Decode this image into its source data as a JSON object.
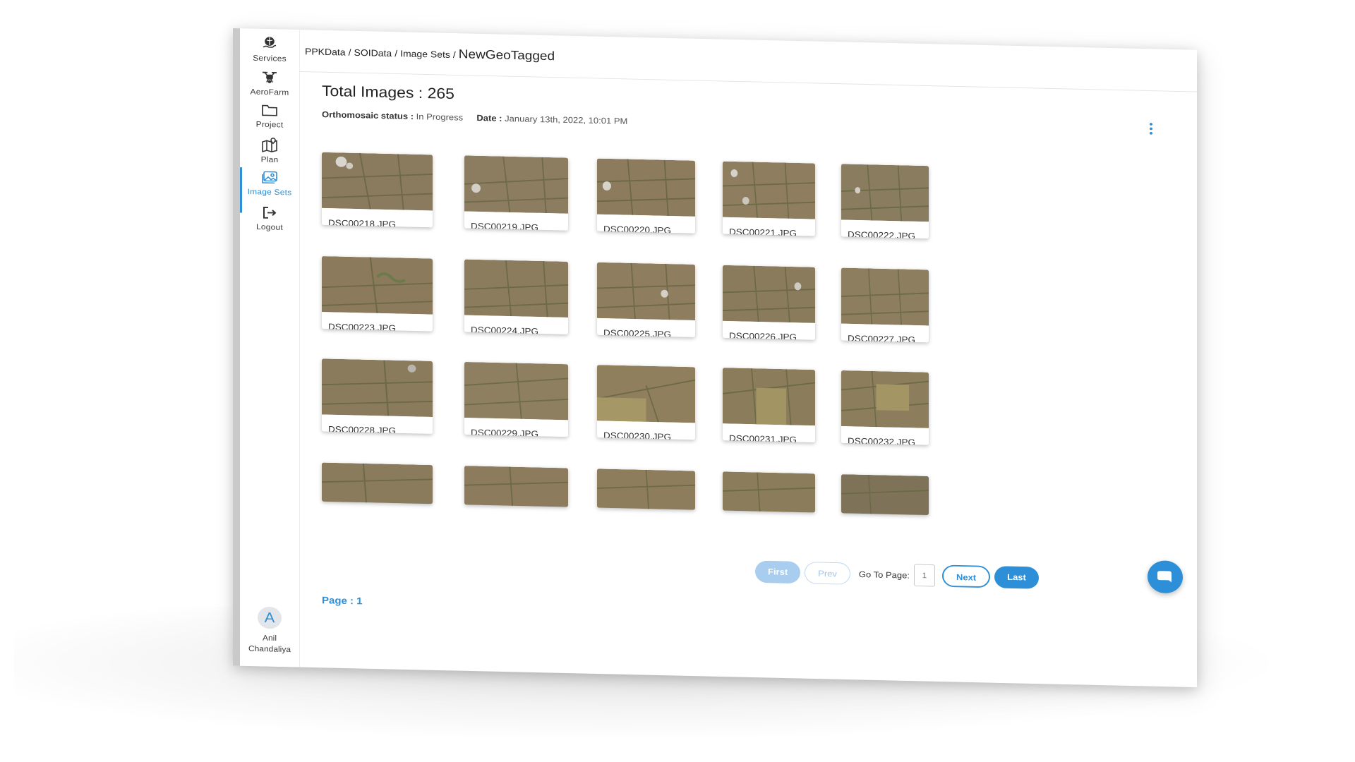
{
  "sidebar": {
    "items": [
      {
        "label": "Services",
        "icon": "globe-hand-icon",
        "active": false
      },
      {
        "label": "AeroFarm",
        "icon": "drone-icon",
        "active": false
      },
      {
        "label": "Project",
        "icon": "folder-icon",
        "active": false
      },
      {
        "label": "Plan",
        "icon": "map-pin-icon",
        "active": false
      },
      {
        "label": "Image Sets",
        "icon": "images-icon",
        "active": true
      },
      {
        "label": "Logout",
        "icon": "logout-icon",
        "active": false
      }
    ],
    "user": {
      "initial": "A",
      "first_name": "Anil",
      "last_name": "Chandaliya"
    }
  },
  "header": {
    "breadcrumb": [
      "PPKData",
      "SOIData",
      "Image Sets"
    ],
    "current": "NewGeoTagged"
  },
  "main": {
    "total_label": "Total Images : 265",
    "ortho_label": "Orthomosaic status :",
    "ortho_value": "In Progress",
    "date_label": "Date :",
    "date_value": "January 13th, 2022, 10:01 PM"
  },
  "images": [
    {
      "name": "DSC00218.JPG"
    },
    {
      "name": "DSC00219.JPG"
    },
    {
      "name": "DSC00220.JPG"
    },
    {
      "name": "DSC00221.JPG"
    },
    {
      "name": "DSC00222.JPG"
    },
    {
      "name": "DSC00223.JPG"
    },
    {
      "name": "DSC00224.JPG"
    },
    {
      "name": "DSC00225.JPG"
    },
    {
      "name": "DSC00226.JPG"
    },
    {
      "name": "DSC00227.JPG"
    },
    {
      "name": "DSC00228.JPG"
    },
    {
      "name": "DSC00229.JPG"
    },
    {
      "name": "DSC00230.JPG"
    },
    {
      "name": "DSC00231.JPG"
    },
    {
      "name": "DSC00232.JPG"
    },
    {
      "name": ""
    },
    {
      "name": ""
    },
    {
      "name": ""
    },
    {
      "name": ""
    },
    {
      "name": ""
    }
  ],
  "pagination": {
    "first": "First",
    "prev": "Prev",
    "goto_label": "Go To Page:",
    "goto_value": "1",
    "next": "Next",
    "last": "Last",
    "page_indicator": "Page : 1"
  },
  "colors": {
    "accent": "#2d8fd8",
    "accent_light": "#a9cdef"
  }
}
